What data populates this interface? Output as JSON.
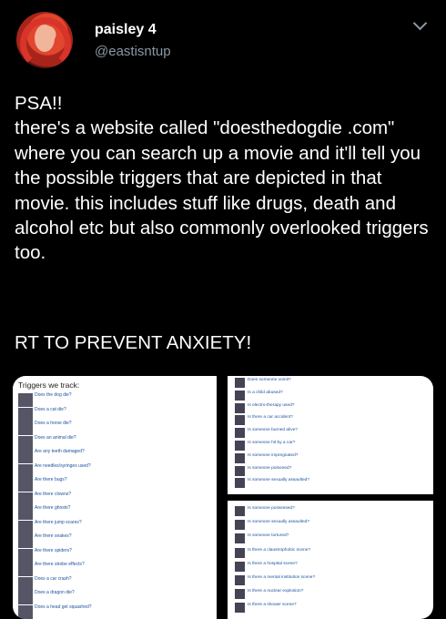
{
  "header": {
    "display_name": "paisley 4",
    "handle": "@eastisntup"
  },
  "tweet": {
    "text": "PSA!!\nthere's a website called \"doesthedogdie .com\" where you can search up a movie and it'll tell you the possible triggers that are depicted in that movie. this includes stuff like drugs, death and alcohol etc but also commonly overlooked triggers too.",
    "closing": "RT TO PREVENT ANXIETY!"
  },
  "media": {
    "left_header": "Triggers we track:",
    "left_items": [
      "Does the dog die?",
      "Does a cat die?",
      "Does a horse die?",
      "Does an animal die?",
      "Are any teeth damaged?",
      "Are needles/syringes used?",
      "Are there bugs?",
      "Are there clowns?",
      "Are there ghosts?",
      "Are there jump scares?",
      "Are there snakes?",
      "Are there spiders?",
      "Are there strobe effects?",
      "Does a car crash?",
      "Does a dragon die?",
      "Does a head get squashed?"
    ],
    "right_top_items": [
      "Does someone vomit?",
      "Is a child abused?",
      "Is electro-therapy used?",
      "Is there a car accident?",
      "Is someone burned alive?",
      "Is someone hit by a car?",
      "Is someone impregnated?",
      "Is someone poisoned?",
      "Is someone sexually assaulted?"
    ],
    "right_bottom_items": [
      "Is someone possessed?",
      "Is someone sexually assaulted?",
      "Is someone tortured?",
      "Is there a claustrophobic scene?",
      "Is there a hospital scene?",
      "Is there a mental institution scene?",
      "Is there a nuclear explosion?",
      "Is there a shower scene?"
    ]
  }
}
